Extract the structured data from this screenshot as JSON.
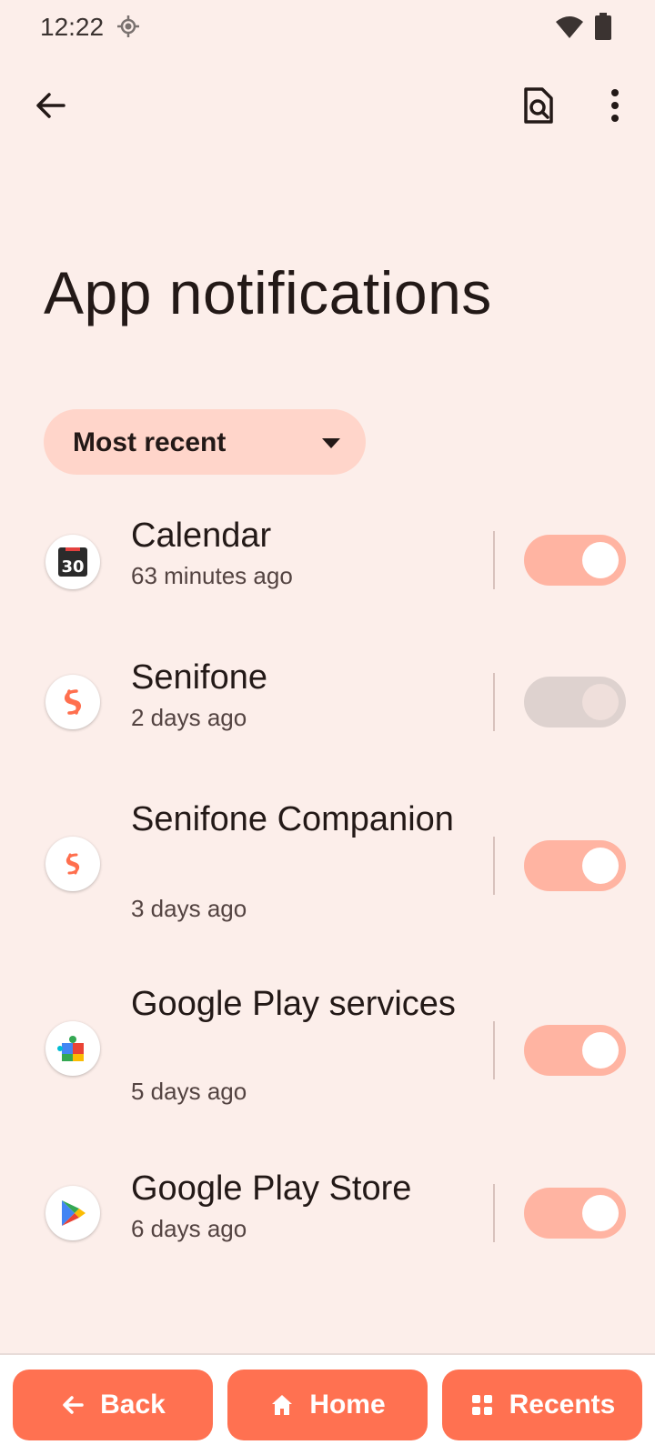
{
  "status_bar": {
    "time": "12:22",
    "icons": [
      "location-icon",
      "wifi-icon",
      "battery-icon"
    ]
  },
  "toolbar": {
    "back_icon": "arrow-back-icon",
    "search_icon": "search-settings-icon",
    "more_icon": "more-vert-icon"
  },
  "page": {
    "title": "App notifications"
  },
  "sort": {
    "selected": "Most recent"
  },
  "apps": [
    {
      "name": "Calendar",
      "time": "63 minutes ago",
      "enabled": true,
      "icon": "calendar-icon"
    },
    {
      "name": "Senifone",
      "time": "2 days ago",
      "enabled": false,
      "icon": "senifone-icon"
    },
    {
      "name": "Senifone Companion",
      "time": "3 days ago",
      "enabled": true,
      "icon": "senifone-companion-icon"
    },
    {
      "name": "Google Play services",
      "time": "5 days ago",
      "enabled": true,
      "icon": "play-services-icon"
    },
    {
      "name": "Google Play Store",
      "time": "6 days ago",
      "enabled": true,
      "icon": "play-store-icon"
    }
  ],
  "calendar_icon_text": "30",
  "nav": {
    "back": "Back",
    "home": "Home",
    "recents": "Recents"
  },
  "colors": {
    "background": "#FCEEEA",
    "accent": "#FF7151",
    "toggle_on": "#FFB4A2",
    "toggle_off": "#DED2CF",
    "chip": "#FFD5CA"
  }
}
